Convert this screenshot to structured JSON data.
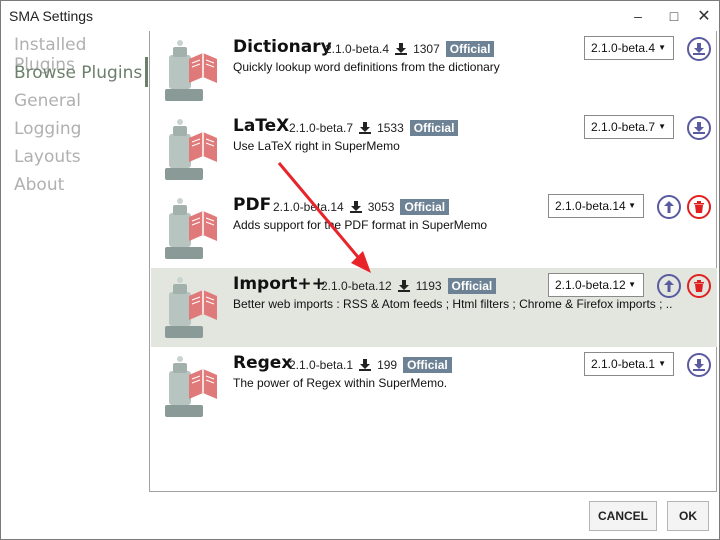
{
  "window": {
    "title": "SMA Settings"
  },
  "titlebar": {
    "minimize": "–",
    "maximize": "□",
    "close": "✕"
  },
  "sidebar": {
    "items": [
      {
        "label": "Installed Plugins"
      },
      {
        "label": "Browse Plugins"
      },
      {
        "label": "General"
      },
      {
        "label": "Logging"
      },
      {
        "label": "Layouts"
      },
      {
        "label": "About"
      }
    ]
  },
  "plugins": [
    {
      "name": "Dictionary",
      "version": "2.1.0-beta.4",
      "downloads": "1307",
      "badge": "Official",
      "description": "Quickly lookup word definitions from the dictionary",
      "selected_version": "2.1.0-beta.4"
    },
    {
      "name": "LaTeX",
      "version": "2.1.0-beta.7",
      "downloads": "1533",
      "badge": "Official",
      "description": "Use LaTeX right in SuperMemo",
      "selected_version": "2.1.0-beta.7"
    },
    {
      "name": "PDF",
      "version": "2.1.0-beta.14",
      "downloads": "3053",
      "badge": "Official",
      "description": "Adds support for the PDF format in SuperMemo",
      "selected_version": "2.1.0-beta.14"
    },
    {
      "name": "Import++",
      "version": "2.1.0-beta.12",
      "downloads": "1193",
      "badge": "Official",
      "description": "Better web imports : RSS & Atom feeds ; Html filters ; Chrome & Firefox imports ; ...",
      "selected_version": "2.1.0-beta.12"
    },
    {
      "name": "Regex",
      "version": "2.1.0-beta.1",
      "downloads": "199",
      "badge": "Official",
      "description": "The power of Regex within SuperMemo.",
      "selected_version": "2.1.0-beta.1"
    }
  ],
  "footer": {
    "cancel": "CANCEL",
    "ok": "OK"
  },
  "colors": {
    "accent": "#6b7f6b",
    "badge": "#6d8294",
    "action_blue": "#5a5aa0",
    "action_red": "#e02020",
    "highlight_row": "#e2e6df",
    "annotation_arrow": "#e8232a"
  }
}
